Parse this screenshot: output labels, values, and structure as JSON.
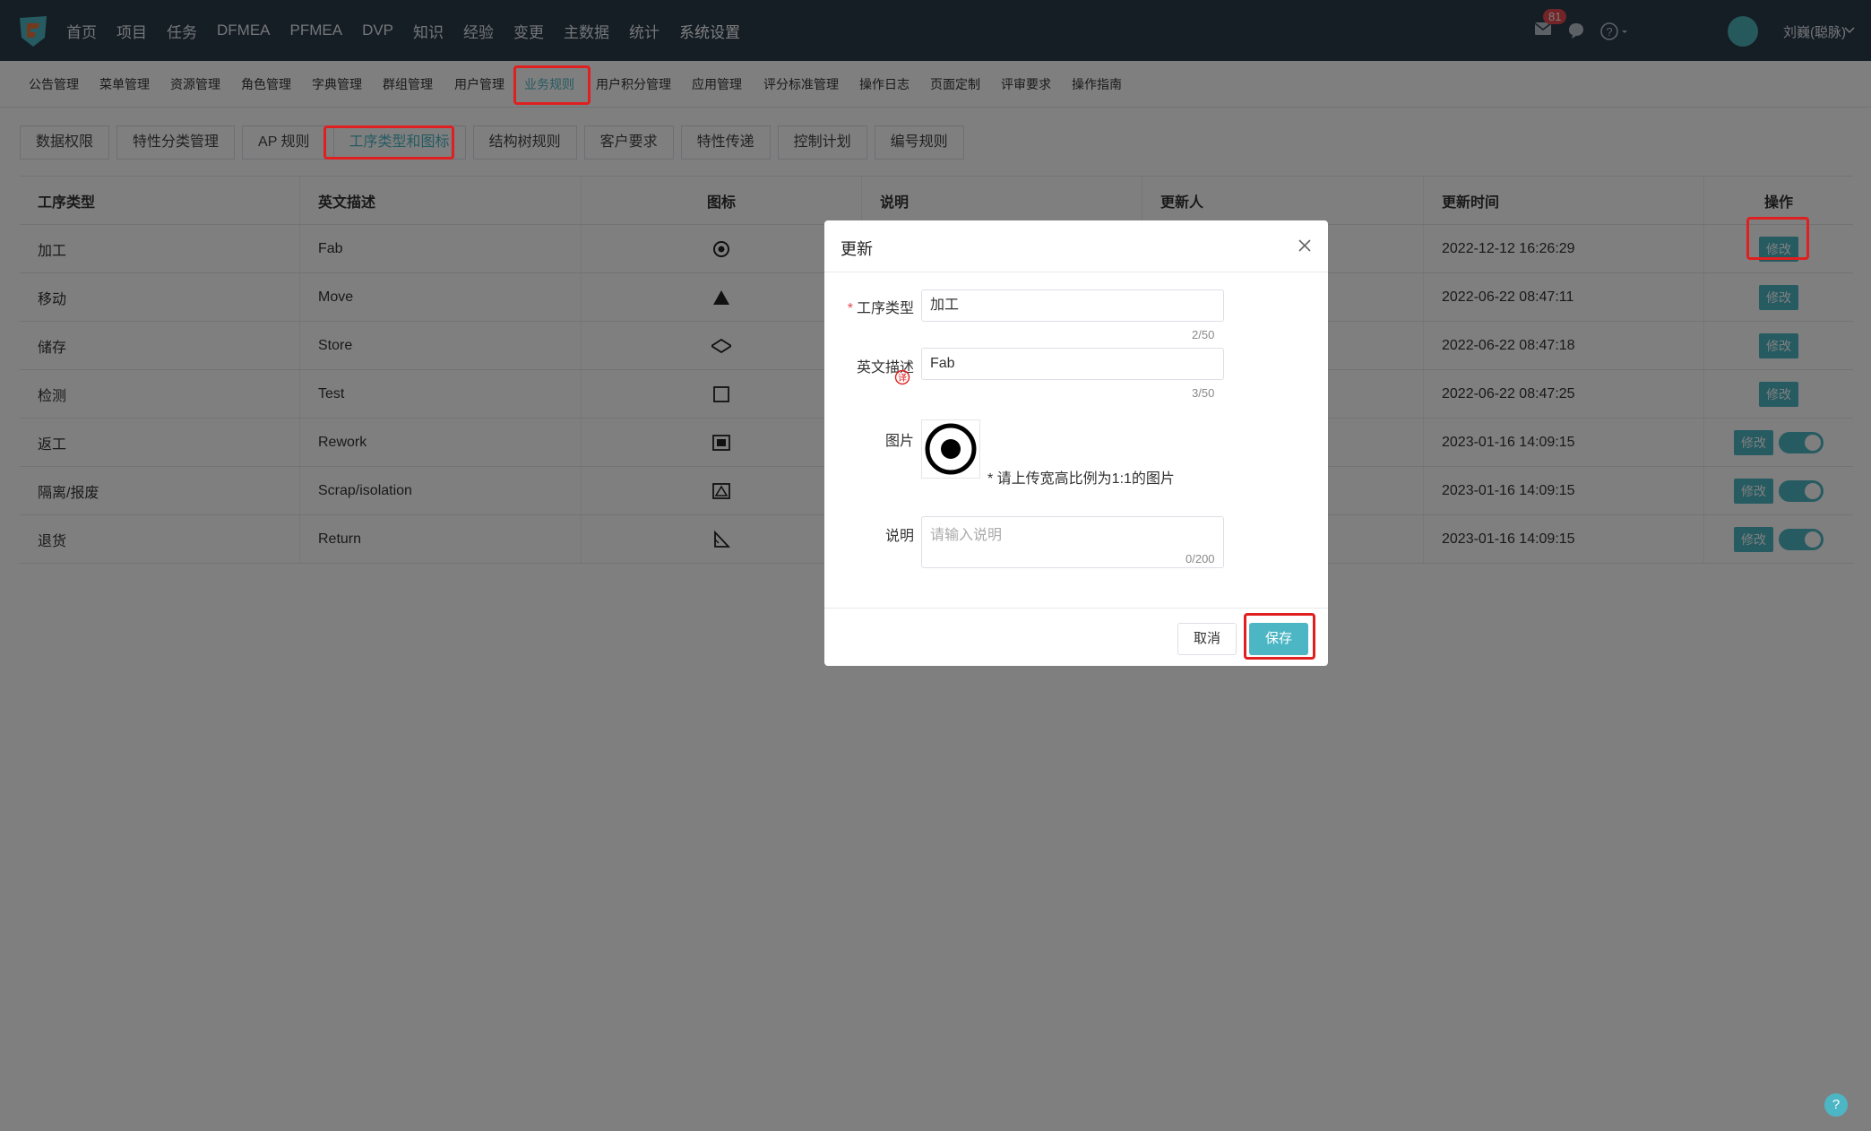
{
  "topnav": {
    "items": [
      "首页",
      "项目",
      "任务",
      "DFMEA",
      "PFMEA",
      "DVP",
      "知识",
      "经验",
      "变更",
      "主数据",
      "统计",
      "系统设置"
    ],
    "active_index": 11,
    "mail_badge": "81",
    "username": "刘巍(聪脉)"
  },
  "submenu": {
    "items": [
      "公告管理",
      "菜单管理",
      "资源管理",
      "角色管理",
      "字典管理",
      "群组管理",
      "用户管理",
      "业务规则",
      "用户积分管理",
      "应用管理",
      "评分标准管理",
      "操作日志",
      "页面定制",
      "评审要求",
      "操作指南"
    ],
    "active_index": 7
  },
  "tabs": {
    "items": [
      "数据权限",
      "特性分类管理",
      "AP 规则",
      "工序类型和图标",
      "结构树规则",
      "客户要求",
      "特性传递",
      "控制计划",
      "编号规则"
    ],
    "active_index": 3
  },
  "table": {
    "headers": [
      "工序类型",
      "英文描述",
      "图标",
      "说明",
      "更新人",
      "更新时间",
      "操作"
    ],
    "rows": [
      {
        "type": "加工",
        "en": "Fab",
        "icon": "circle-dot-icon",
        "desc": "",
        "updater": "",
        "time": "2022-12-12 16:26:29",
        "edit": "修改",
        "toggle": false
      },
      {
        "type": "移动",
        "en": "Move",
        "icon": "triangle-icon",
        "desc": "",
        "updater": "",
        "time": "2022-06-22 08:47:11",
        "edit": "修改",
        "toggle": false
      },
      {
        "type": "储存",
        "en": "Store",
        "icon": "diamond-icon",
        "desc": "",
        "updater": "",
        "time": "2022-06-22 08:47:18",
        "edit": "修改",
        "toggle": false
      },
      {
        "type": "检测",
        "en": "Test",
        "icon": "square-icon",
        "desc": "",
        "updater": "",
        "time": "2022-06-22 08:47:25",
        "edit": "修改",
        "toggle": false
      },
      {
        "type": "返工",
        "en": "Rework",
        "icon": "framed-square-icon",
        "desc": "",
        "updater": "",
        "time": "2023-01-16 14:09:15",
        "edit": "修改",
        "toggle": true
      },
      {
        "type": "隔离/报废",
        "en": "Scrap/isolation",
        "icon": "framed-triangle-icon",
        "desc": "",
        "updater": "",
        "time": "2023-01-16 14:09:15",
        "edit": "修改",
        "toggle": true
      },
      {
        "type": "退货",
        "en": "Return",
        "icon": "return-ruler-icon",
        "desc": "",
        "updater": "",
        "time": "2023-01-16 14:09:15",
        "edit": "修改",
        "toggle": true
      }
    ]
  },
  "dialog": {
    "title": "更新",
    "field_type_label": "工序类型",
    "field_type_value": "加工",
    "field_type_count": "2/50",
    "field_en_label": "英文描述",
    "field_en_value": "Fab",
    "field_en_count": "3/50",
    "field_img_label": "图片",
    "img_hint": "* 请上传宽高比例为1:1的图片",
    "field_desc_label": "说明",
    "desc_placeholder": "请输入说明",
    "desc_count": "0/200",
    "cancel_label": "取消",
    "save_label": "保存"
  },
  "help_bubble": "?",
  "colors": {
    "topnav_bg": "#2b3a4a",
    "accent": "#4db6c4",
    "highlight": "#e02020"
  }
}
